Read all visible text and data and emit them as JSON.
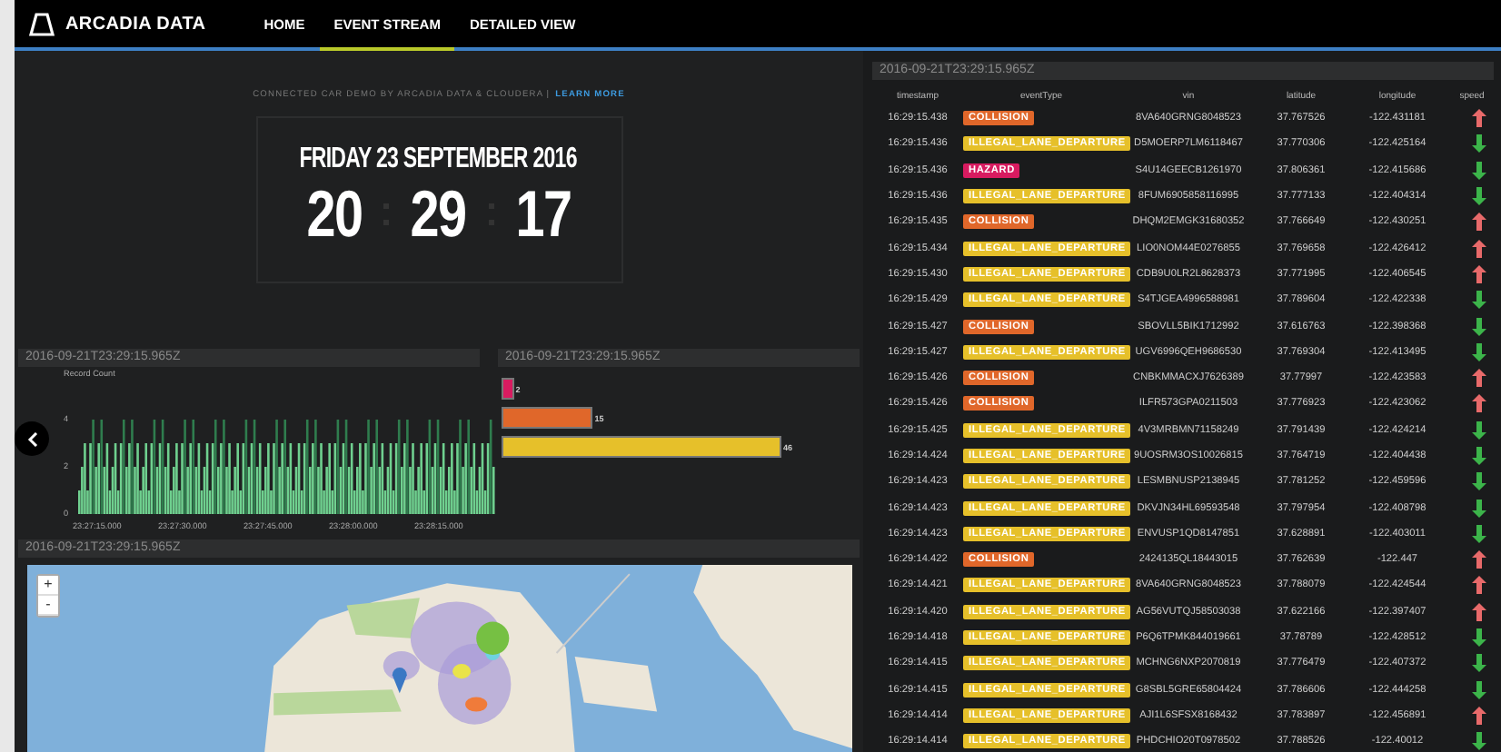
{
  "nav": {
    "brand": "ARCADIA DATA",
    "tabs": [
      {
        "label": "HOME",
        "selected": false
      },
      {
        "label": "EVENT STREAM",
        "selected": true
      },
      {
        "label": "DETAILED VIEW",
        "selected": false
      }
    ]
  },
  "clock": {
    "caption": "CONNECTED CAR DEMO BY ARCADIA DATA & CLOUDERA |",
    "link": "LEARN MORE",
    "date": "FRIDAY 23 SEPTEMBER 2016",
    "hours": "20",
    "minutes": "29",
    "seconds": "17"
  },
  "histogram": {
    "title": "2016-09-21T23:29:15.965Z",
    "ylabel": "Record Count",
    "yticks": [
      "4",
      "2",
      "0"
    ],
    "xticks": [
      "23:27:15.000",
      "23:27:30.000",
      "23:27:45.000",
      "23:28:00.000",
      "23:28:15.000"
    ]
  },
  "bar_panel": {
    "title": "2016-09-21T23:29:15.965Z",
    "bars": [
      {
        "color": "#d81b60",
        "value": "2"
      },
      {
        "color": "#e0672a",
        "value": "15"
      },
      {
        "color": "#e6c02a",
        "value": "46"
      }
    ]
  },
  "map": {
    "title": "2016-09-21T23:29:15.965Z",
    "zoom_in": "+",
    "zoom_out": "-"
  },
  "table": {
    "title": "2016-09-21T23:29:15.965Z",
    "columns": [
      "timestamp",
      "eventType",
      "vin",
      "latitude",
      "longitude",
      "speed"
    ],
    "rows": [
      {
        "timestamp": "16:29:15.438",
        "event": "COLLISION",
        "color": "#e0672a",
        "vin": "8VA640GRNG8048523",
        "latitude": "37.767526",
        "longitude": "-122.431181",
        "speed_up": true
      },
      {
        "timestamp": "16:29:15.436",
        "event": "ILLEGAL_LANE_DEPARTURE",
        "color": "#e6c02a",
        "vin": "D5MOERP7LM6118467",
        "latitude": "37.770306",
        "longitude": "-122.425164",
        "speed_up": false
      },
      {
        "timestamp": "16:29:15.436",
        "event": "HAZARD",
        "color": "#d81b60",
        "vin": "S4U14GEECB1261970",
        "latitude": "37.806361",
        "longitude": "-122.415686",
        "speed_up": false
      },
      {
        "timestamp": "16:29:15.436",
        "event": "ILLEGAL_LANE_DEPARTURE",
        "color": "#e6c02a",
        "vin": "8FUM6905858116995",
        "latitude": "37.777133",
        "longitude": "-122.404314",
        "speed_up": false
      },
      {
        "timestamp": "16:29:15.435",
        "event": "COLLISION",
        "color": "#e0672a",
        "vin": "DHQM2EMGK31680352",
        "latitude": "37.766649",
        "longitude": "-122.430251",
        "speed_up": true
      },
      {
        "timestamp": "16:29:15.434",
        "event": "ILLEGAL_LANE_DEPARTURE",
        "color": "#e6c02a",
        "vin": "LIO0NOM44E0276855",
        "latitude": "37.769658",
        "longitude": "-122.426412",
        "speed_up": true
      },
      {
        "timestamp": "16:29:15.430",
        "event": "ILLEGAL_LANE_DEPARTURE",
        "color": "#e6c02a",
        "vin": "CDB9U0LR2L8628373",
        "latitude": "37.771995",
        "longitude": "-122.406545",
        "speed_up": true
      },
      {
        "timestamp": "16:29:15.429",
        "event": "ILLEGAL_LANE_DEPARTURE",
        "color": "#e6c02a",
        "vin": "S4TJGEA4996588981",
        "latitude": "37.789604",
        "longitude": "-122.422338",
        "speed_up": false
      },
      {
        "timestamp": "16:29:15.427",
        "event": "COLLISION",
        "color": "#e0672a",
        "vin": "SBOVLL5BIK1712992",
        "latitude": "37.616763",
        "longitude": "-122.398368",
        "speed_up": false
      },
      {
        "timestamp": "16:29:15.427",
        "event": "ILLEGAL_LANE_DEPARTURE",
        "color": "#e6c02a",
        "vin": "UGV6996QEH9686530",
        "latitude": "37.769304",
        "longitude": "-122.413495",
        "speed_up": false
      },
      {
        "timestamp": "16:29:15.426",
        "event": "COLLISION",
        "color": "#e0672a",
        "vin": "CNBKMMACXJ7626389",
        "latitude": "37.77997",
        "longitude": "-122.423583",
        "speed_up": true
      },
      {
        "timestamp": "16:29:15.426",
        "event": "COLLISION",
        "color": "#e0672a",
        "vin": "ILFR573GPA0211503",
        "latitude": "37.776923",
        "longitude": "-122.423062",
        "speed_up": true
      },
      {
        "timestamp": "16:29:15.425",
        "event": "ILLEGAL_LANE_DEPARTURE",
        "color": "#e6c02a",
        "vin": "4V3MRBMN71158249",
        "latitude": "37.791439",
        "longitude": "-122.424214",
        "speed_up": false
      },
      {
        "timestamp": "16:29:14.424",
        "event": "ILLEGAL_LANE_DEPARTURE",
        "color": "#e6c02a",
        "vin": "9UOSRM3OS10026815",
        "latitude": "37.764719",
        "longitude": "-122.404438",
        "speed_up": false
      },
      {
        "timestamp": "16:29:14.423",
        "event": "ILLEGAL_LANE_DEPARTURE",
        "color": "#e6c02a",
        "vin": "LESMBNUSP2138945",
        "latitude": "37.781252",
        "longitude": "-122.459596",
        "speed_up": false
      },
      {
        "timestamp": "16:29:14.423",
        "event": "ILLEGAL_LANE_DEPARTURE",
        "color": "#e6c02a",
        "vin": "DKVJN34HL69593548",
        "latitude": "37.797954",
        "longitude": "-122.408798",
        "speed_up": false
      },
      {
        "timestamp": "16:29:14.423",
        "event": "ILLEGAL_LANE_DEPARTURE",
        "color": "#e6c02a",
        "vin": "ENVUSP1QD8147851",
        "latitude": "37.628891",
        "longitude": "-122.403011",
        "speed_up": false
      },
      {
        "timestamp": "16:29:14.422",
        "event": "COLLISION",
        "color": "#e0672a",
        "vin": "2424135QL18443015",
        "latitude": "37.762639",
        "longitude": "-122.447",
        "speed_up": true
      },
      {
        "timestamp": "16:29:14.421",
        "event": "ILLEGAL_LANE_DEPARTURE",
        "color": "#e6c02a",
        "vin": "8VA640GRNG8048523",
        "latitude": "37.788079",
        "longitude": "-122.424544",
        "speed_up": true
      },
      {
        "timestamp": "16:29:14.420",
        "event": "ILLEGAL_LANE_DEPARTURE",
        "color": "#e6c02a",
        "vin": "AG56VUTQJ58503038",
        "latitude": "37.622166",
        "longitude": "-122.397407",
        "speed_up": true
      },
      {
        "timestamp": "16:29:14.418",
        "event": "ILLEGAL_LANE_DEPARTURE",
        "color": "#e6c02a",
        "vin": "P6Q6TPMK844019661",
        "latitude": "37.78789",
        "longitude": "-122.428512",
        "speed_up": false
      },
      {
        "timestamp": "16:29:14.415",
        "event": "ILLEGAL_LANE_DEPARTURE",
        "color": "#e6c02a",
        "vin": "MCHNG6NXP2070819",
        "latitude": "37.776479",
        "longitude": "-122.407372",
        "speed_up": false
      },
      {
        "timestamp": "16:29:14.415",
        "event": "ILLEGAL_LANE_DEPARTURE",
        "color": "#e6c02a",
        "vin": "G8SBL5GRE65804424",
        "latitude": "37.786606",
        "longitude": "-122.444258",
        "speed_up": false
      },
      {
        "timestamp": "16:29:14.414",
        "event": "ILLEGAL_LANE_DEPARTURE",
        "color": "#e6c02a",
        "vin": "AJI1L6SFSX8168432",
        "latitude": "37.783897",
        "longitude": "-122.456891",
        "speed_up": true
      },
      {
        "timestamp": "16:29:14.414",
        "event": "ILLEGAL_LANE_DEPARTURE",
        "color": "#e6c02a",
        "vin": "PHDCHIO20T0978502",
        "latitude": "37.788526",
        "longitude": "-122.40012",
        "speed_up": false
      }
    ]
  }
}
